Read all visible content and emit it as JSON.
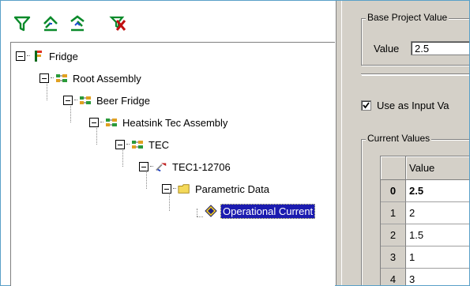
{
  "toolbar": {
    "buttons": [
      {
        "name": "filter-icon",
        "color": "#0a8a2a"
      },
      {
        "name": "move-up-icon",
        "color": "#0a8a2a"
      },
      {
        "name": "move-down-icon",
        "color": "#0a8a2a"
      },
      {
        "name": "clear-filter-icon",
        "color": "#c01010"
      }
    ]
  },
  "tree": {
    "nodes": [
      {
        "label": "Fridge",
        "icon": "fridge-icon"
      },
      {
        "label": "Root Assembly",
        "icon": "assembly-icon"
      },
      {
        "label": "Beer Fridge",
        "icon": "assembly-icon"
      },
      {
        "label": "Heatsink Tec Assembly",
        "icon": "assembly-icon"
      },
      {
        "label": "TEC",
        "icon": "assembly-icon"
      },
      {
        "label": "TEC1-12706",
        "icon": "part-icon"
      },
      {
        "label": "Parametric Data",
        "icon": "folder-icon"
      },
      {
        "label": "Operational Current",
        "icon": "parameter-icon",
        "selected": true
      }
    ]
  },
  "right": {
    "base_group_title": "Base Project Value",
    "value_label": "Value",
    "value_input": "2.5",
    "use_as_input_label": "Use as Input Va",
    "use_as_input_checked": true,
    "current_group_title": "Current Values",
    "grid": {
      "header": "Value",
      "rows": [
        {
          "num": "0",
          "value": "2.5",
          "bold": true
        },
        {
          "num": "1",
          "value": "2"
        },
        {
          "num": "2",
          "value": "1.5"
        },
        {
          "num": "3",
          "value": "1"
        },
        {
          "num": "4",
          "value": "3"
        }
      ]
    }
  },
  "colors": {
    "selection": "#1b1bb0",
    "panel": "#d4d0c8",
    "frame": "#5aa0c8"
  }
}
